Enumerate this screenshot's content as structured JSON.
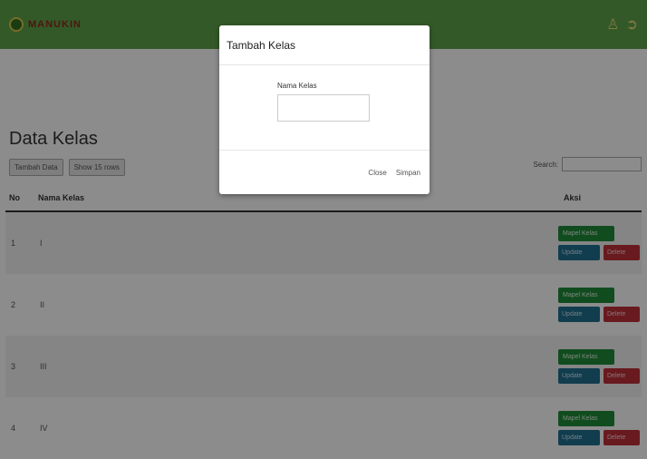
{
  "header": {
    "brand": "MANUKIN"
  },
  "page": {
    "title": "Data Kelas",
    "buttons": [
      "Tambah Data",
      "Show 15 rows"
    ],
    "search_label": "Search:",
    "search_value": ""
  },
  "table": {
    "headers": [
      "No",
      "Nama Kelas",
      "Aksi"
    ],
    "rows": [
      {
        "no": "1",
        "nama": "I"
      },
      {
        "no": "2",
        "nama": "II"
      },
      {
        "no": "3",
        "nama": "III"
      },
      {
        "no": "4",
        "nama": "IV"
      }
    ],
    "actions": {
      "mapel": "Mapel Kelas",
      "update": "Update",
      "delete": "Delete"
    }
  },
  "modal": {
    "title": "Tambah Kelas",
    "field_label": "Nama Kelas",
    "field_value": "",
    "close_label": "Close",
    "save_label": "Simpan"
  },
  "colors": {
    "navbar": "#5fa24a",
    "mapel_button": "#1f8a3a",
    "update_button": "#1f6f8f",
    "delete_button": "#c0303a"
  },
  "icons": {
    "user": "user-icon",
    "logout": "logout-icon",
    "logo": "brand-logo-icon"
  }
}
